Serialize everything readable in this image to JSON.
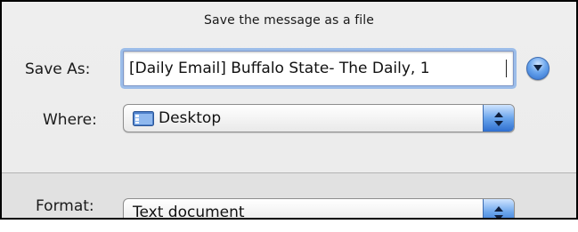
{
  "dialog": {
    "title": "Save the message as a file",
    "save_as_label": "Save As:",
    "save_as_value": "[Daily Email] Buffalo State- The Daily, 1",
    "where_label": "Where:",
    "where_value": "Desktop",
    "where_icon": "desktop-folder-icon",
    "format_label": "Format:",
    "format_value": "Text document"
  },
  "colors": {
    "accent": "#6aa5ec",
    "focus_ring": "#9cbde9",
    "panel": "#ececec"
  }
}
